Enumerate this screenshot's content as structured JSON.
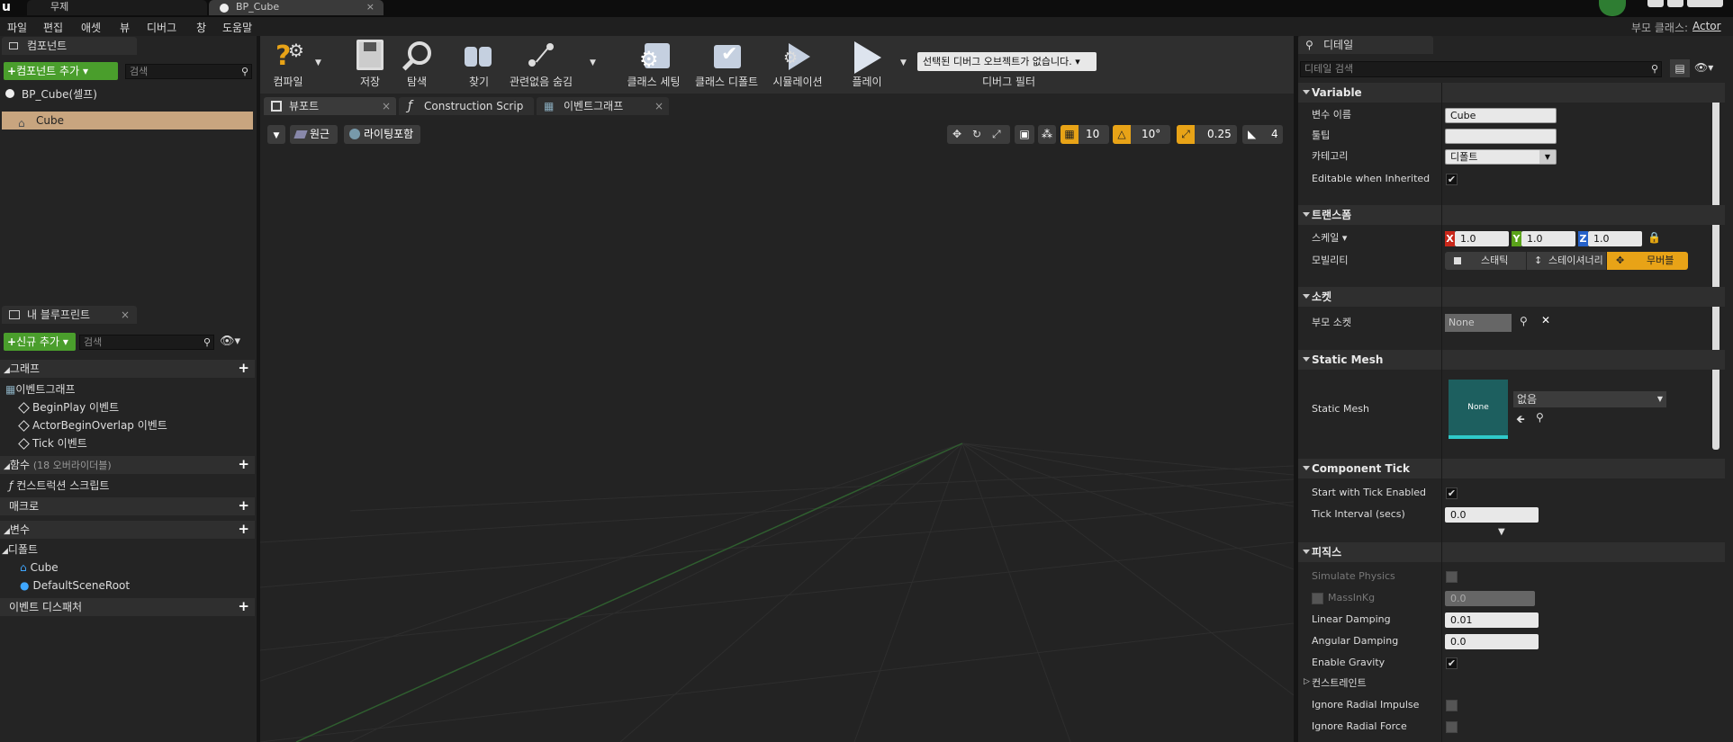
{
  "window": {
    "tabs": [
      {
        "label": "무제"
      },
      {
        "label": "BP_Cube"
      }
    ],
    "parent_class_label": "부모 클래스:",
    "parent_class_value": "Actor"
  },
  "menu": {
    "items": [
      "파일",
      "편집",
      "애셋",
      "뷰",
      "디버그",
      "창",
      "도움말"
    ]
  },
  "components": {
    "tab_label": "컴포넌트",
    "add_button": "컴포넌트 추가",
    "search_placeholder": "검색",
    "root_label": "BP_Cube(셀프)",
    "items": [
      {
        "label": "Cube"
      }
    ]
  },
  "my_blueprint": {
    "tab_label": "내 블루프린트",
    "add_button": "신규 추가",
    "search_placeholder": "검색",
    "sections": {
      "graph": "그래프",
      "event_graph": "이벤트그래프",
      "events": [
        "BeginPlay 이벤트",
        "ActorBeginOverlap 이벤트",
        "Tick 이벤트"
      ],
      "functions": "함수",
      "functions_count": "(18 오버라이더블)",
      "construction_script": "컨스트럭션 스크립트",
      "macros": "매크로",
      "variables": "변수",
      "default_category": "디폴트",
      "vars": [
        "Cube",
        "DefaultSceneRoot"
      ],
      "event_dispatchers": "이벤트 디스패처"
    }
  },
  "toolbar": {
    "compile": "컴파일",
    "save": "저장",
    "browse": "탐색",
    "find": "찾기",
    "hide_unrelated": "관련없음 숨김",
    "class_settings": "클래스 세팅",
    "class_defaults": "클래스 디폴트",
    "simulation": "시뮬레이션",
    "play": "플레이",
    "debug_dropdown": "선택된 디버그 오브젝트가 없습니다.",
    "debug_filter": "디버그 필터"
  },
  "editor_tabs": [
    {
      "label": "뷰포트"
    },
    {
      "label": "Construction Scrip"
    },
    {
      "label": "이벤트그래프"
    }
  ],
  "viewport": {
    "perspective": "원근",
    "lit": "라이팅포함",
    "grid_snap": "10",
    "rotation_snap": "10°",
    "scale_snap": "0.25",
    "camera_speed": "4"
  },
  "details": {
    "tab_label": "디테일",
    "search_placeholder": "디테일 검색",
    "variable": {
      "title": "Variable",
      "var_name_label": "변수 이름",
      "var_name_value": "Cube",
      "tooltip_label": "툴팁",
      "tooltip_value": "",
      "category_label": "카테고리",
      "category_value": "디폴트",
      "editable_label": "Editable when Inherited"
    },
    "transform": {
      "title": "트랜스폼",
      "scale_label": "스케일",
      "x": "1.0",
      "y": "1.0",
      "z": "1.0",
      "mobility_label": "모빌리티",
      "mobility_static": "스태틱",
      "mobility_stationary": "스테이셔너리",
      "mobility_movable": "무버블"
    },
    "sockets": {
      "title": "소켓",
      "parent_socket_label": "부모 소켓",
      "parent_socket_value": "None"
    },
    "static_mesh": {
      "title": "Static Mesh",
      "label": "Static Mesh",
      "thumb": "None",
      "value": "없음"
    },
    "component_tick": {
      "title": "Component Tick",
      "start_label": "Start with Tick Enabled",
      "interval_label": "Tick Interval (secs)",
      "interval_value": "0.0"
    },
    "physics": {
      "title": "피직스",
      "simulate_label": "Simulate Physics",
      "mass_label": "MassInKg",
      "mass_value": "0.0",
      "linear_label": "Linear Damping",
      "linear_value": "0.01",
      "angular_label": "Angular Damping",
      "angular_value": "0.0",
      "gravity_label": "Enable Gravity",
      "constraints_label": "컨스트레인트",
      "radial_impulse_label": "Ignore Radial Impulse",
      "radial_force_label": "Ignore Radial Force"
    }
  },
  "colors": {
    "accent_green": "#4a9e2c",
    "accent_orange": "#e8a317",
    "selection": "#c8a57f"
  }
}
